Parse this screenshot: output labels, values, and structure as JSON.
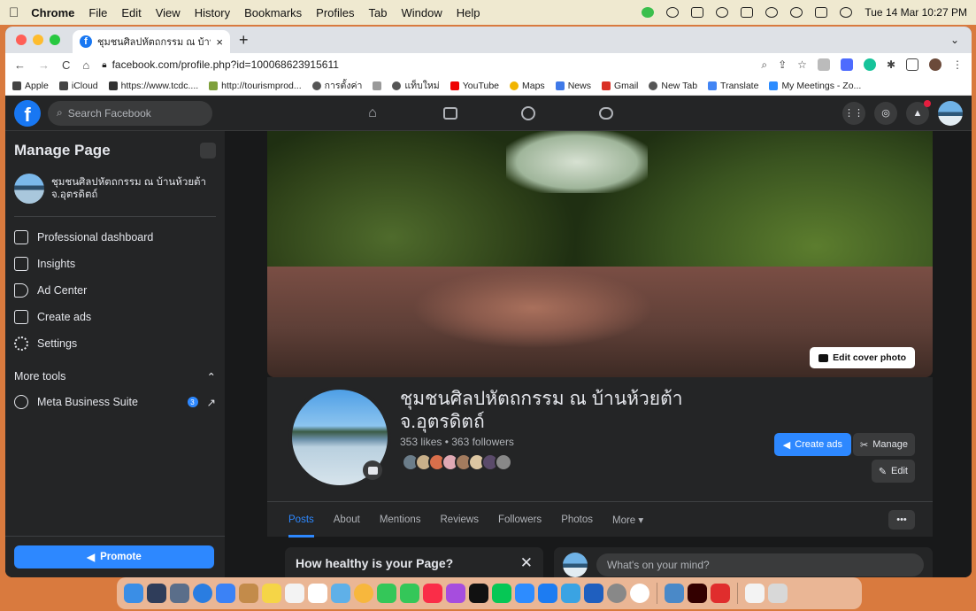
{
  "menubar": {
    "app": "Chrome",
    "items": [
      "File",
      "Edit",
      "View",
      "History",
      "Bookmarks",
      "Profiles",
      "Tab",
      "Window",
      "Help"
    ],
    "datetime": "Tue 14 Mar  10:27 PM"
  },
  "browser": {
    "tab_title": "ชุมชนศิลปหัตถกรรม ณ บ้านห้วยต้",
    "url": "facebook.com/profile.php?id=100068623915611",
    "bookmarks": [
      "Apple",
      "iCloud",
      "https://www.tcdc....",
      "http://tourismprod...",
      "การตั้งค่า",
      "แท็บใหม่",
      "YouTube",
      "Maps",
      "News",
      "Gmail",
      "New Tab",
      "Translate",
      "My Meetings - Zo..."
    ]
  },
  "fbnav": {
    "logo": "f",
    "search_placeholder": "Search Facebook"
  },
  "sidebar": {
    "title": "Manage Page",
    "page_name": "ชุมชนศิลปหัตถกรรม ณ บ้านห้วยต้า จ.อุตรดิตถ์",
    "items": [
      {
        "label": "Professional dashboard",
        "icon": "dashboard-icon"
      },
      {
        "label": "Insights",
        "icon": "insights-icon"
      },
      {
        "label": "Ad Center",
        "icon": "megaphone-icon"
      },
      {
        "label": "Create ads",
        "icon": "pencil-icon"
      },
      {
        "label": "Settings",
        "icon": "gear-icon"
      }
    ],
    "more_tools": "More tools",
    "meta_suite": "Meta Business Suite",
    "meta_badge": "3",
    "promote": "Promote"
  },
  "profile": {
    "edit_cover": "Edit cover photo",
    "name": "ชุมชนศิลปหัตถกรรม ณ บ้านห้วยต้า จ.อุตรดิตถ์",
    "stats": "353 likes • 363 followers",
    "create_ads": "Create ads",
    "manage": "Manage",
    "edit": "Edit"
  },
  "tabs": [
    "Posts",
    "About",
    "Mentions",
    "Reviews",
    "Followers",
    "Photos",
    "More ▾"
  ],
  "health": {
    "title": "How healthy is your Page?"
  },
  "composer": {
    "placeholder": "What's on your mind?"
  },
  "colors": {
    "accent": "#2d88ff",
    "fb_blue": "#1877f2",
    "surface": "#242526",
    "background": "#18191a"
  }
}
